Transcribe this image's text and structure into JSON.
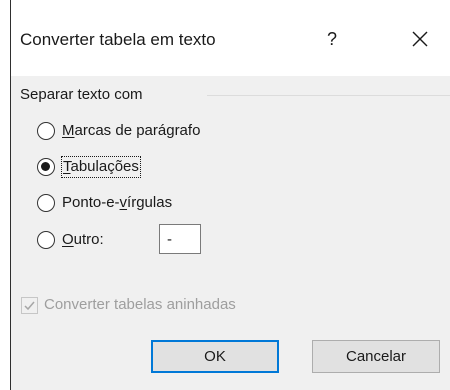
{
  "dialog": {
    "title": "Converter tabela em texto",
    "help_label": "?",
    "close_icon": "close-icon"
  },
  "group": {
    "label": "Separar texto com",
    "options": [
      {
        "mnemonic": "M",
        "rest": "arcas de parágrafo",
        "checked": false
      },
      {
        "mnemonic": "T",
        "rest": "abulações",
        "checked": true
      },
      {
        "prefix": "Ponto-e-",
        "mnemonic": "v",
        "rest": "írgulas",
        "checked": false
      },
      {
        "mnemonic": "O",
        "rest": "utro:",
        "checked": false
      }
    ],
    "other_value": "-"
  },
  "nested": {
    "label": "Converter tabelas aninhadas",
    "checked": true,
    "enabled": false
  },
  "buttons": {
    "ok": "OK",
    "cancel": "Cancelar"
  },
  "colors": {
    "content_bg": "#f0f0f0",
    "default_button_border": "#0078d7",
    "disabled_text": "#9e9e9e"
  }
}
